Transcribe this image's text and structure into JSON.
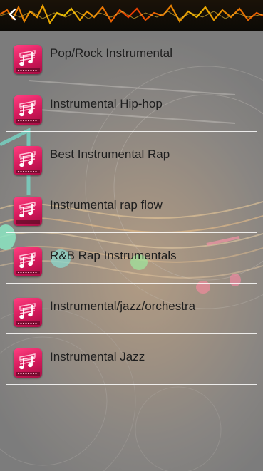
{
  "header": {
    "back_icon": "chevron-left-icon"
  },
  "colors": {
    "header_bg": "#0c0a06",
    "icon_pink": "#d3185a",
    "divider": "#ffffff",
    "label_text": "#1e1e1e"
  },
  "list": {
    "items": [
      {
        "label": "Pop/Rock Instrumental",
        "icon": "music-notes-icon"
      },
      {
        "label": "Instrumental Hip-hop",
        "icon": "music-notes-icon"
      },
      {
        "label": "Best Instrumental Rap",
        "icon": "music-notes-icon"
      },
      {
        "label": "Instrumental rap flow",
        "icon": "music-notes-icon"
      },
      {
        "label": "R&B Rap Instrumentals",
        "icon": "music-notes-icon"
      },
      {
        "label": "Instrumental/jazz/orchestra",
        "icon": "music-notes-icon"
      },
      {
        "label": "Instrumental Jazz",
        "icon": "music-notes-icon"
      }
    ]
  }
}
